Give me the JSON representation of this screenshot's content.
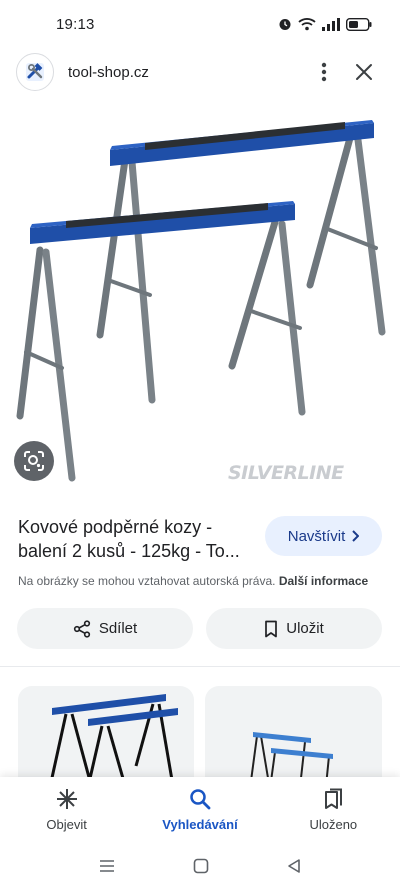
{
  "status_bar": {
    "time": "19:13"
  },
  "header": {
    "site_name": "tool-shop.cz",
    "logo_icon": "hammer-wrench-icon"
  },
  "image": {
    "watermark": "SILVERLINE"
  },
  "result": {
    "title_line1": "Kovové podpěrné kozy -",
    "title_line2": "balení 2 kusů - 125kg - To...",
    "visit_label": "Navštívit",
    "copyright_text": "Na obrázky se mohou vztahovat autorská práva.",
    "more_info_label": "Další informace"
  },
  "actions": {
    "share_label": "Sdílet",
    "save_label": "Uložit"
  },
  "bottom_nav": {
    "items": [
      {
        "label": "Objevit",
        "icon": "asterisk-icon",
        "active": false
      },
      {
        "label": "Vyhledávání",
        "icon": "search-icon",
        "active": true
      },
      {
        "label": "Uloženo",
        "icon": "bookmarks-icon",
        "active": false
      }
    ]
  },
  "colors": {
    "accent": "#1a56c4",
    "visit_bg": "#e8f0fe",
    "trestle_blue": "#1f4fa8",
    "trestle_leg": "#6e767c"
  }
}
